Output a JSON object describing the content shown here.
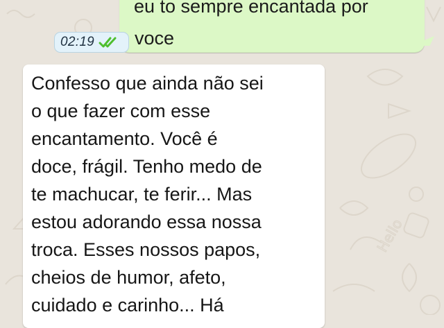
{
  "chat": {
    "outgoing": {
      "lines": [
        "eu to sempre encantada por",
        "voce"
      ],
      "time": "02:19",
      "status_icon": "double-check-read-icon",
      "status_color": "#4fbf2f",
      "bubble_color": "#dcf8c6"
    },
    "incoming": {
      "lines": [
        "Confesso que ainda não sei",
        "o que fazer com esse",
        "encantamento. Você é",
        "doce, frágil. Tenho medo de",
        "te machucar, te ferir... Mas",
        "estou adorando essa nossa",
        "troca. Esses nossos papos,",
        "cheios de humor, afeto,",
        "cuidado e carinho... Há"
      ],
      "bubble_color": "#ffffff"
    },
    "wallpaper": {
      "color": "#e9e4dc",
      "doodle_text": "Hello"
    }
  }
}
